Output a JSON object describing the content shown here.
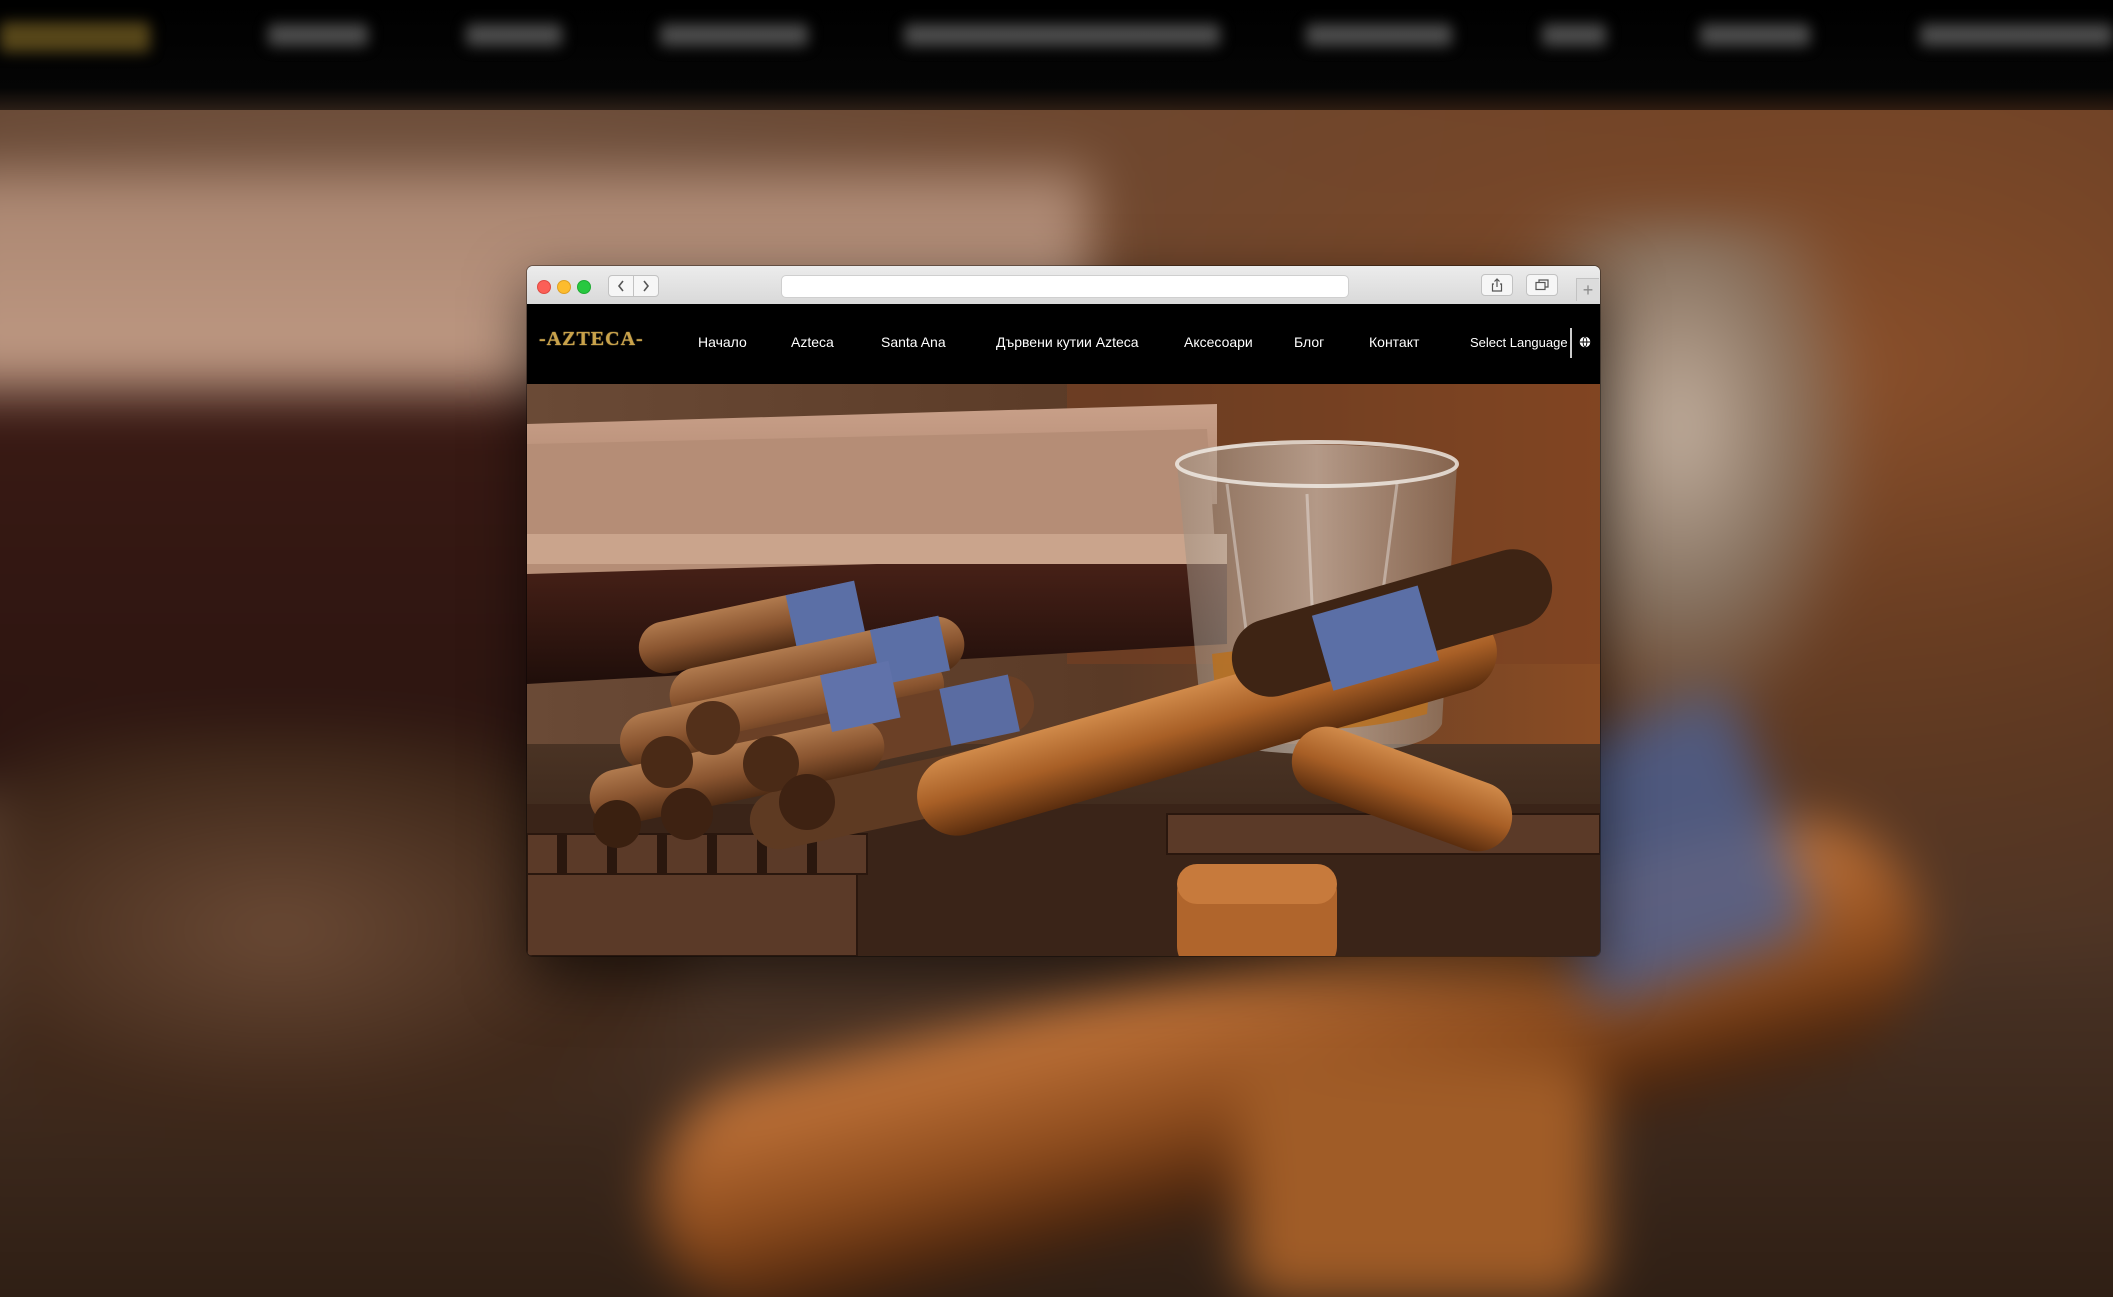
{
  "site": {
    "logo": "-AZTECA-",
    "menu": [
      {
        "label": "Начало"
      },
      {
        "label": "Azteca"
      },
      {
        "label": "Santa Ana"
      },
      {
        "label": "Дървени кутии Azteca"
      },
      {
        "label": "Аксесоари"
      },
      {
        "label": "Блог"
      },
      {
        "label": "Контакт"
      }
    ],
    "language_selector": "Select Language"
  },
  "browser": {
    "address_value": "",
    "new_tab_label": "+"
  },
  "icons": {
    "back": "chevron-left-icon",
    "forward": "chevron-right-icon",
    "share": "share-icon",
    "tabs": "tabs-overview-icon",
    "globe": "globe-icon"
  },
  "colors": {
    "header_bg": "#000000",
    "logo_gold": "#c9a24a",
    "menu_text": "#ffffff",
    "close": "#fc5f57",
    "minimize": "#fdbc2e",
    "zoom": "#28c840"
  }
}
